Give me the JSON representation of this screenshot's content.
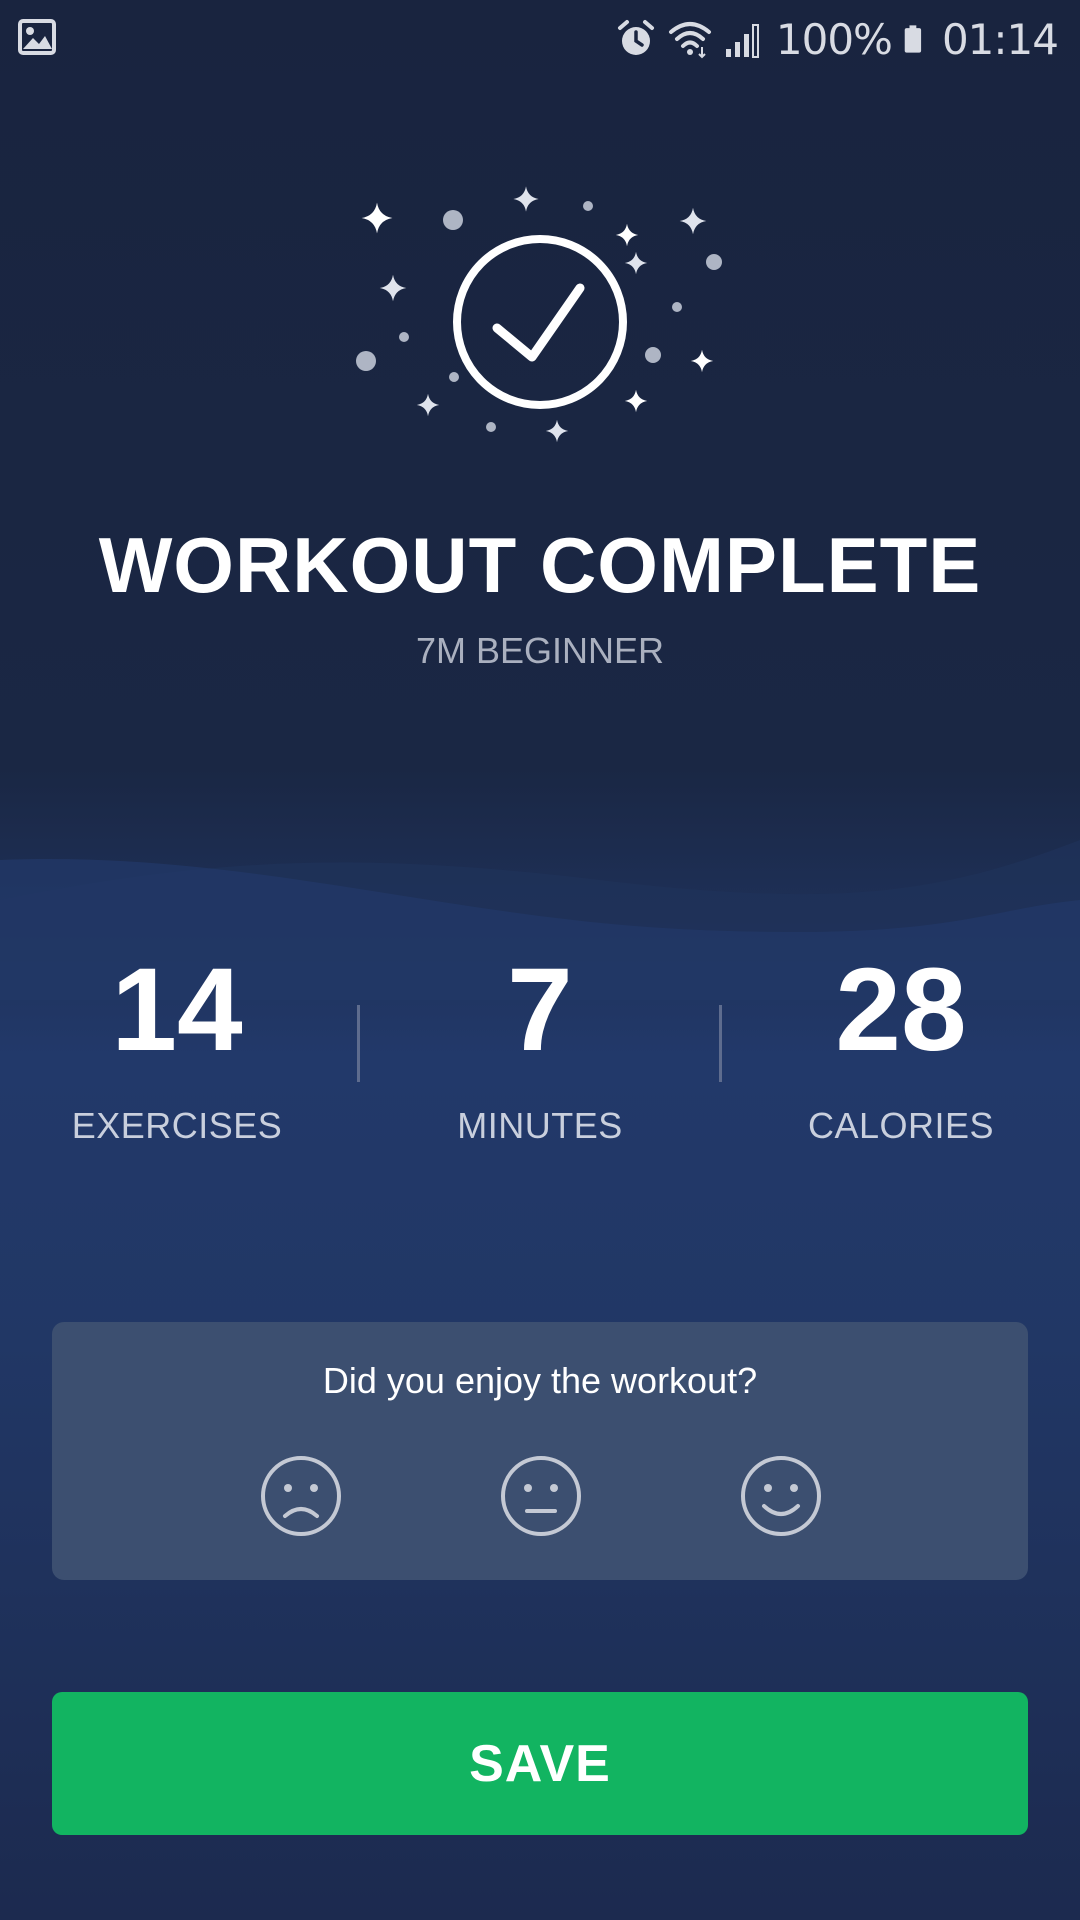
{
  "status_bar": {
    "left_icon": "image-icon",
    "icons": [
      "alarm-icon",
      "wifi-icon",
      "signal-icon",
      "battery-icon"
    ],
    "battery": "100%",
    "time": "01:14"
  },
  "hero": {
    "icon": "check-circle-icon"
  },
  "header": {
    "title": "WORKOUT COMPLETE",
    "subtitle": "7M BEGINNER"
  },
  "stats": [
    {
      "value": "14",
      "label": "EXERCISES"
    },
    {
      "value": "7",
      "label": "MINUTES"
    },
    {
      "value": "28",
      "label": "CALORIES"
    }
  ],
  "rating": {
    "question": "Did you enjoy the workout?",
    "options": [
      "sad-face-icon",
      "neutral-face-icon",
      "happy-face-icon"
    ]
  },
  "actions": {
    "save_label": "SAVE"
  },
  "colors": {
    "background_top": "#19243f",
    "background_mid": "#22396a",
    "card": "#3c4f70",
    "accent_green": "#12b461",
    "text_muted": "#aab0bf"
  }
}
